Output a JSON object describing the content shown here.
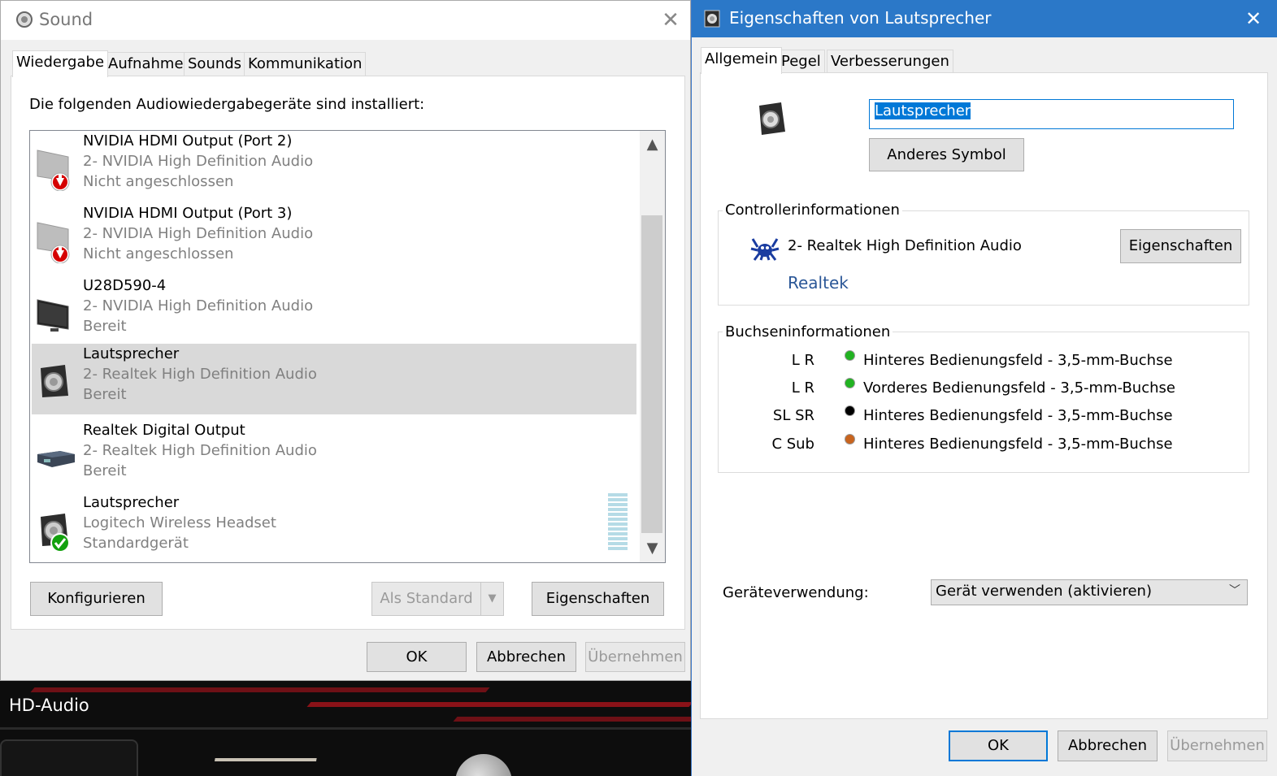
{
  "background_app": {
    "title": "HD-Audio"
  },
  "sound_dialog": {
    "title": "Sound",
    "close_glyph": "✕",
    "tabs": [
      {
        "label": "Wiedergabe",
        "active": true
      },
      {
        "label": "Aufnahme",
        "active": false
      },
      {
        "label": "Sounds",
        "active": false
      },
      {
        "label": "Kommunikation",
        "active": false
      }
    ],
    "description": "Die folgenden Audiowiedergabegeräte sind installiert:",
    "devices": [
      {
        "name": "NVIDIA HDMI Output (Port 2)",
        "driver": "2- NVIDIA High Definition Audio",
        "status": "Nicht angeschlossen",
        "icon": "monitor-disconnected-icon",
        "selected": false
      },
      {
        "name": "NVIDIA HDMI Output (Port 3)",
        "driver": "2- NVIDIA High Definition Audio",
        "status": "Nicht angeschlossen",
        "icon": "monitor-disconnected-icon",
        "selected": false
      },
      {
        "name": "U28D590-4",
        "driver": "2- NVIDIA High Definition Audio",
        "status": "Bereit",
        "icon": "monitor-icon",
        "selected": false
      },
      {
        "name": "Lautsprecher",
        "driver": "2- Realtek High Definition Audio",
        "status": "Bereit",
        "icon": "speaker-icon",
        "selected": true
      },
      {
        "name": "Realtek Digital Output",
        "driver": "2- Realtek High Definition Audio",
        "status": "Bereit",
        "icon": "digital-output-icon",
        "selected": false
      },
      {
        "name": "Lautsprecher",
        "driver": "Logitech Wireless Headset",
        "status": "Standardgerät",
        "icon": "speaker-default-icon",
        "selected": false
      }
    ],
    "buttons": {
      "configure": "Konfigurieren",
      "set_default": "Als Standard",
      "properties": "Eigenschaften",
      "ok": "OK",
      "cancel": "Abbrechen",
      "apply": "Übernehmen"
    }
  },
  "properties_dialog": {
    "title": "Eigenschaften von Lautsprecher",
    "close_glyph": "✕",
    "tabs": [
      {
        "label": "Allgemein",
        "active": true
      },
      {
        "label": "Pegel",
        "active": false
      },
      {
        "label": "Verbesserungen",
        "active": false
      }
    ],
    "device_name_value": "Lautsprecher",
    "change_icon_label": "Anderes Symbol",
    "controller": {
      "group_label": "Controllerinformationen",
      "name": "2- Realtek High Definition Audio",
      "properties_label": "Eigenschaften",
      "vendor_link": "Realtek"
    },
    "jacks": {
      "group_label": "Buchseninformationen",
      "items": [
        {
          "channels": "L R",
          "color": "#22b322",
          "description": "Hinteres Bedienungsfeld - 3,5-mm-Buchse"
        },
        {
          "channels": "L R",
          "color": "#22b322",
          "description": "Vorderes Bedienungsfeld - 3,5-mm-Buchse"
        },
        {
          "channels": "SL SR",
          "color": "#000000",
          "description": "Hinteres Bedienungsfeld - 3,5-mm-Buchse"
        },
        {
          "channels": "C Sub",
          "color": "#c8641e",
          "description": "Hinteres Bedienungsfeld - 3,5-mm-Buchse"
        }
      ]
    },
    "usage": {
      "label": "Geräteverwendung:",
      "selected": "Gerät verwenden (aktivieren)"
    },
    "buttons": {
      "ok": "OK",
      "cancel": "Abbrechen",
      "apply": "Übernehmen"
    }
  },
  "colors": {
    "accent": "#0078d7",
    "titlebar": "#2b78c8",
    "link": "#2b5797"
  }
}
